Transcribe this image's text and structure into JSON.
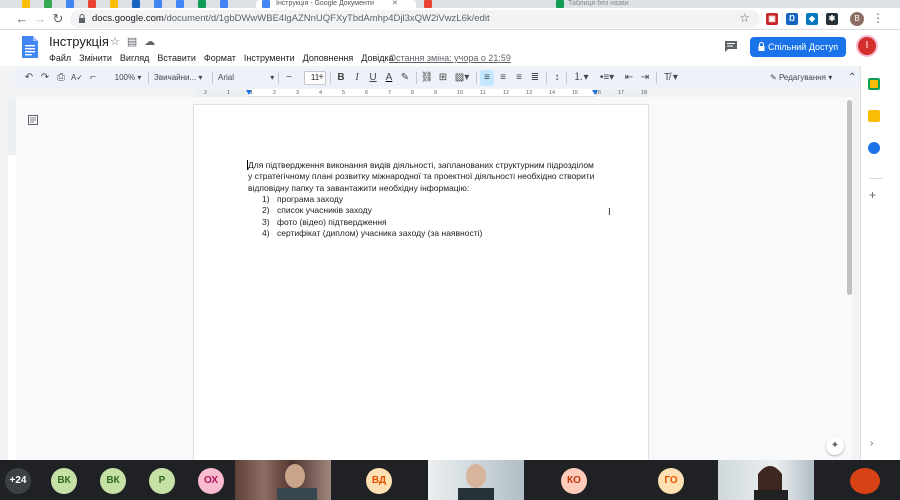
{
  "browser": {
    "url_host": "docs.google.com",
    "url_path": "/document/d/1gbDWwWBE4lgAZNnUQFXyTbdAmhp4Djl3xQW2iVwzL6k/edit",
    "active_tab_title": "Інструкція - Google Документи",
    "other_tab_title": "Таблиця без назви",
    "profile_letter": "В"
  },
  "docs": {
    "title": "Інструкція",
    "menu": [
      "Файл",
      "Змінити",
      "Вигляд",
      "Вставити",
      "Формат",
      "Інструменти",
      "Доповнення",
      "Довідка"
    ],
    "last_edit": "Остання зміна: учора о 21:59",
    "share_label": "Спільний Доступ",
    "avatar_letter": "І"
  },
  "toolbar": {
    "zoom": "100%",
    "style": "Звичайни...",
    "font": "Arial",
    "font_size": "11",
    "mode": "Редагування"
  },
  "ruler": {
    "numbers": [
      "2",
      "1",
      "1",
      "2",
      "3",
      "4",
      "5",
      "6",
      "7",
      "8",
      "9",
      "10",
      "11",
      "12",
      "13",
      "14",
      "15",
      "16",
      "17",
      "18"
    ]
  },
  "document": {
    "paragraph": "Для підтвердження виконання видів діяльності, запланованих структурним підрозділом у стратегічному плані розвитку міжнародної та проектної діяльності необхідно створити відповідну папку та завантажити необхідну  інформацію:",
    "list": [
      {
        "num": "1)",
        "text": "програма заходу"
      },
      {
        "num": "2)",
        "text": "список учасників заходу"
      },
      {
        "num": "3)",
        "text": "фото (відео) підтвердження"
      },
      {
        "num": "4)",
        "text": "сертифікат (диплом) учасника заходу (за наявності)"
      }
    ]
  },
  "call": {
    "overflow": "+24",
    "participants": [
      {
        "initials": "ВК",
        "color": "#c5e1a5",
        "text_color": "#33691e"
      },
      {
        "initials": "ВК",
        "color": "#c5e1a5",
        "text_color": "#33691e"
      },
      {
        "initials": "Р",
        "color": "#c5e1a5",
        "text_color": "#33691e"
      },
      {
        "initials": "ОХ",
        "color": "#f8bbd0",
        "text_color": "#ad1457"
      },
      {
        "initials": "ВД",
        "color": "#ffe0b2",
        "text_color": "#e65100"
      },
      {
        "initials": "КО",
        "color": "#ffccbc",
        "text_color": "#bf360c"
      },
      {
        "initials": "ГО",
        "color": "#ffe0b2",
        "text_color": "#e65100"
      }
    ]
  },
  "colors": {
    "accent": "#1a73e8",
    "toolbar_bg": "#edf2fa",
    "canvas_bg": "#f8f9fa"
  }
}
